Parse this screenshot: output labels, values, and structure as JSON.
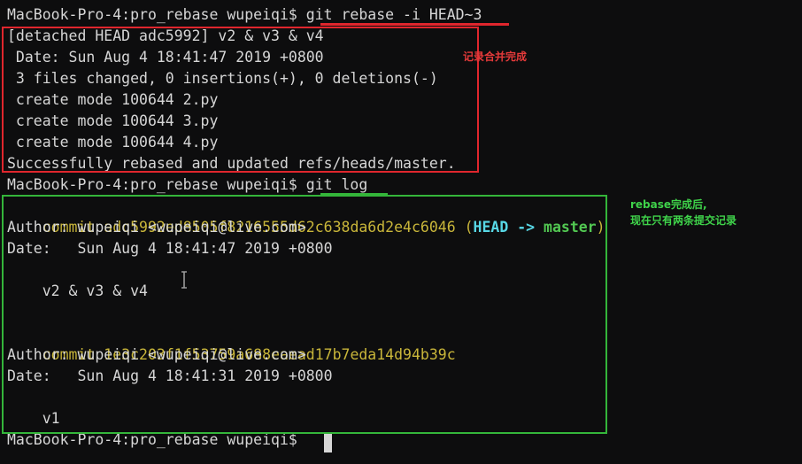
{
  "terminal": {
    "lines": [
      {
        "text": "MacBook-Pro-4:pro_rebase wupeiqi$ git rebase -i HEAD~3"
      },
      {
        "text": "[detached HEAD adc5992] v2 & v3 & v4"
      },
      {
        "text": " Date: Sun Aug 4 18:41:47 2019 +0800"
      },
      {
        "text": " 3 files changed, 0 insertions(+), 0 deletions(-)"
      },
      {
        "text": " create mode 100644 2.py"
      },
      {
        "text": " create mode 100644 3.py"
      },
      {
        "text": " create mode 100644 4.py"
      },
      {
        "text": "Successfully rebased and updated refs/heads/master."
      },
      {
        "text": "MacBook-Pro-4:pro_rebase wupeiqi$ git log"
      },
      {
        "commit_label": "commit ",
        "hash": "adc5992ed8505f8216555d62c638da6d2e4c6046",
        "open": " (",
        "head": "HEAD -> ",
        "branch": "master",
        "close": ")"
      },
      {
        "text": "Author: wupeiqi <wupeiqi@live.com>"
      },
      {
        "text": "Date:   Sun Aug 4 18:41:47 2019 +0800"
      },
      {
        "text": ""
      },
      {
        "text": "    v2 & v3 & v4"
      },
      {
        "text": ""
      },
      {
        "commit_label": "commit ",
        "hash": "1e3c203f1f53759a688eaead17b7eda14d94b39c"
      },
      {
        "text": "Author: wupeiqi <wupeiqi@live.com>"
      },
      {
        "text": "Date:   Sun Aug 4 18:41:31 2019 +0800"
      },
      {
        "text": ""
      },
      {
        "text": "    v1"
      },
      {
        "text": ""
      },
      {
        "text": "MacBook-Pro-4:pro_rebase wupeiqi$ "
      }
    ]
  },
  "annotations": {
    "red_note": "记录合并完成",
    "green_note": "rebase完成后,\n现在只有两条提交记录"
  },
  "colors": {
    "red": "#e0262d",
    "green": "#34b53a",
    "hash_yellow": "#c9b63a",
    "head_cyan": "#58d8e6",
    "branch_green": "#52c852"
  }
}
